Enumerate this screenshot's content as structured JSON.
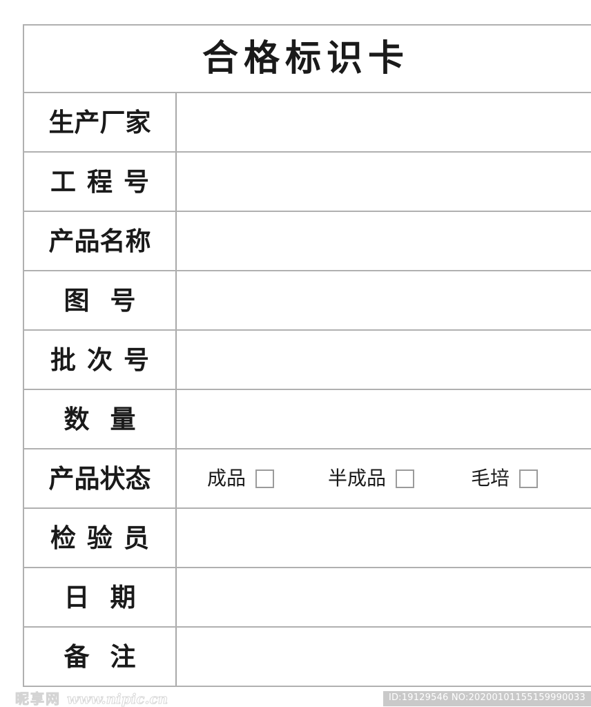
{
  "document": {
    "title": "合格标识卡",
    "rows": [
      {
        "label": "生产厂家",
        "chars": 4,
        "value": ""
      },
      {
        "label": "工程号",
        "chars": 3,
        "value": ""
      },
      {
        "label": "产品名称",
        "chars": 4,
        "value": ""
      },
      {
        "label": "图号",
        "chars": 2,
        "value": ""
      },
      {
        "label": "批次号",
        "chars": 3,
        "value": ""
      },
      {
        "label": "数量",
        "chars": 2,
        "value": ""
      },
      {
        "label": "产品状态",
        "chars": 4,
        "value": ""
      },
      {
        "label": "检验员",
        "chars": 3,
        "value": ""
      },
      {
        "label": "日期",
        "chars": 2,
        "value": ""
      },
      {
        "label": "备注",
        "chars": 2,
        "value": ""
      }
    ],
    "status_options": [
      {
        "label": "成品",
        "checked": false
      },
      {
        "label": "半成品",
        "checked": false
      },
      {
        "label": "毛培",
        "checked": false
      }
    ],
    "colors": {
      "border": "#b0b0b0",
      "inner_border": "#a8a8a8",
      "text": "#1a1a1a",
      "checkbox_border": "#9b9b9b",
      "watermark": "#d4d4d4",
      "id_badge_bg": "#c9c9c9"
    }
  },
  "watermark": {
    "logo_cn": "昵享网",
    "logo_url": "www.nipic.cn",
    "id_text": "ID:19129546 NO:20200101155159990033"
  }
}
